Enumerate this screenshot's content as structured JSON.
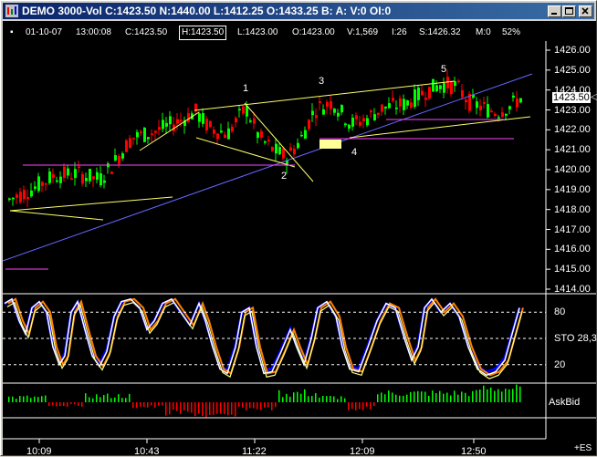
{
  "window": {
    "title": "DEMO 3000-Vol C:1423.50 N:1440.00 L:1412.25 O:1433.25 B: A: V:0 OI:0",
    "buttons": [
      "minimize",
      "maximize",
      "close"
    ]
  },
  "info_bar": {
    "date": "01-10-07",
    "time": "13:00:08",
    "close": "C:1423.50",
    "high": "H:1423.50",
    "low": "L:1423.00",
    "open": "O:1423.00",
    "volume": "V:1,569",
    "interval": "I:26",
    "s_value": "S:1426.32",
    "m_value": "M:0",
    "percent": "52%"
  },
  "price_axis": {
    "labels": [
      "1426.00",
      "1425.00",
      "1424.00",
      "1423.00",
      "1422.00",
      "1421.00",
      "1420.00",
      "1419.00",
      "1418.00",
      "1417.00",
      "1416.00",
      "1415.00",
      "1414.00"
    ],
    "current_price": "1423.50"
  },
  "annotations": [
    "1",
    "2",
    "3",
    "4",
    "5"
  ],
  "stochastic": {
    "label": "STO 28,3",
    "levels": [
      "80",
      "20"
    ]
  },
  "askbid": {
    "label": "AskBid"
  },
  "time_axis": {
    "labels": [
      "10:09",
      "10:43",
      "11:22",
      "12:09",
      "12:50"
    ],
    "symbol": "+ES"
  },
  "colors": {
    "up_bar": "#00ff00",
    "down_bar": "#ff0000",
    "trendline_yellow": "#ffff66",
    "trendline_blue": "#6666ff",
    "horizontal_magenta": "#ff44ff",
    "stoch_white": "#ffffff",
    "stoch_yellow": "#ffff80",
    "stoch_orange": "#ff8000",
    "stoch_blue": "#0000ff",
    "title_bar": "#0a246a"
  }
}
